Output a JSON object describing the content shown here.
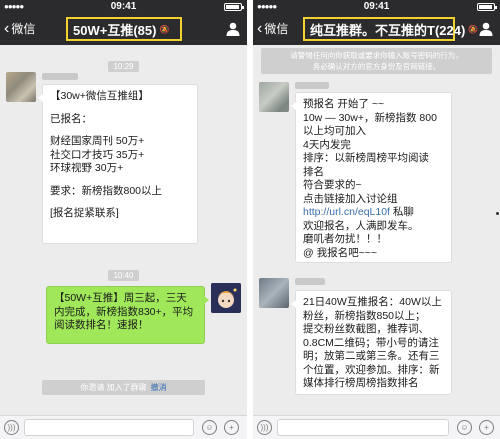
{
  "status": {
    "time": "09:41"
  },
  "left": {
    "back_label": "微信",
    "title": "50W+互推(85)",
    "timestamps": [
      "10:29",
      "10:40"
    ],
    "msg1_lines": [
      "【30w+微信互推组】",
      "",
      "已报名：",
      "",
      "财经国家周刊  50万+",
      "社交口才技巧   35万+",
      "环球视野    30万+",
      "",
      "要求：新榜指数800以上",
      "",
      "[报名捉紧联系]"
    ],
    "msg2_lines": [
      "【50W+互推】周三起，三天",
      "内完成，新榜指数830+，平均",
      "阅读数排名！速报！"
    ],
    "sys_text": "你邀请       加入了群聊",
    "sys_accept": "撤消"
  },
  "right": {
    "back_label": "微信",
    "title": "纯互推群。不互推的T(224)",
    "notice": [
      "请警惕任何向你获取或要求你输入账号密码的行为，",
      "务必确认对方的官方身份及官网链接。"
    ],
    "msg1_lines": [
      "预报名 开始了 ~~",
      "10w — 30w+，新榜指数 800",
      "以上均可加入",
      "4天内发完",
      "排序：以新榜周榜平均阅读",
      "排名",
      "符合要求的~",
      "点击链接加入讨论组"
    ],
    "msg1_link": "http://url.cn/eqL10f",
    "msg1_link_after": "  私聊",
    "msg1_tail_lines": [
      "欢迎报名，人满即发车。",
      "磨叽者勿扰！！！",
      "@ 我报名吧~~~"
    ],
    "msg2_lines": [
      "21日40W互推报名：40W以上",
      "粉丝，新榜指数850以上；",
      "提交粉丝数截图，推荐词、",
      "0.8CM二维码；带小号的请注",
      "明；放第二或第三条。还有三",
      "个位置，欢迎参加。排序：新",
      "媒体排行榜周榜指数排名"
    ]
  }
}
